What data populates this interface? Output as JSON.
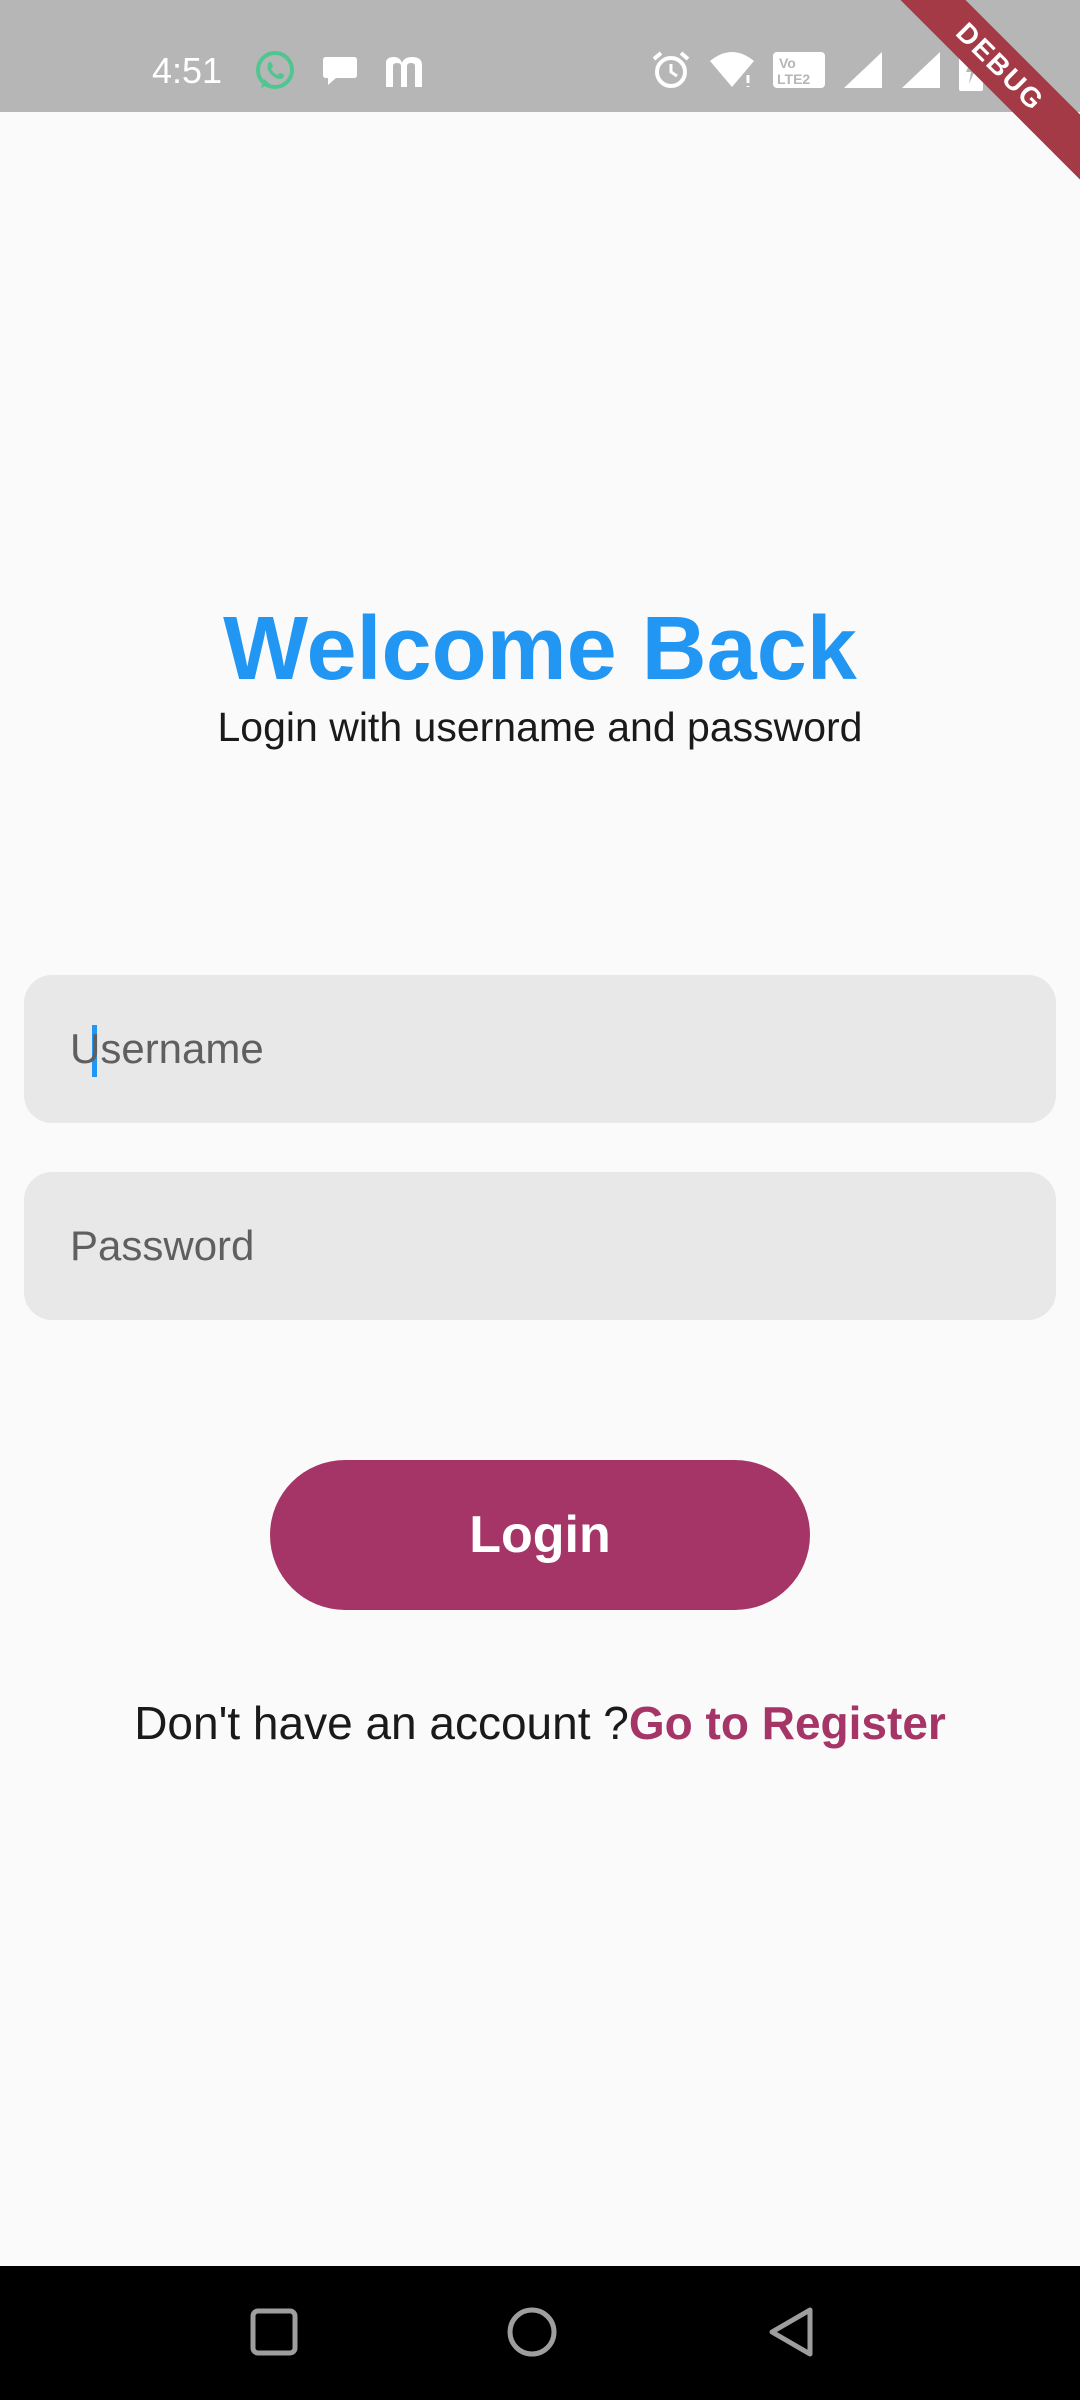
{
  "status_bar": {
    "time": "4:51",
    "left_icons": [
      "whatsapp-icon",
      "chat-icon",
      "m-app-icon"
    ],
    "right_icons": [
      "alarm-icon",
      "wifi-icon",
      "volte-icon",
      "signal-icon",
      "signal-icon-2",
      "battery-icon"
    ]
  },
  "debug_banner": "DEBUG",
  "header": {
    "title": "Welcome Back",
    "subtitle": "Login with username and password"
  },
  "form": {
    "username_placeholder": "Username",
    "username_value": "",
    "password_placeholder": "Password",
    "password_value": ""
  },
  "login_button": "Login",
  "register": {
    "prompt": "Don't have an account ?",
    "link": "Go to Register"
  },
  "nav_bar": {
    "buttons": [
      "recents-icon",
      "home-icon",
      "back-icon"
    ]
  },
  "colors": {
    "title": "#2196f3",
    "accent": "#a53567",
    "field_bg": "#e8e8e8",
    "status_bar": "#b6b6b6",
    "page_bg": "#fafafa"
  }
}
